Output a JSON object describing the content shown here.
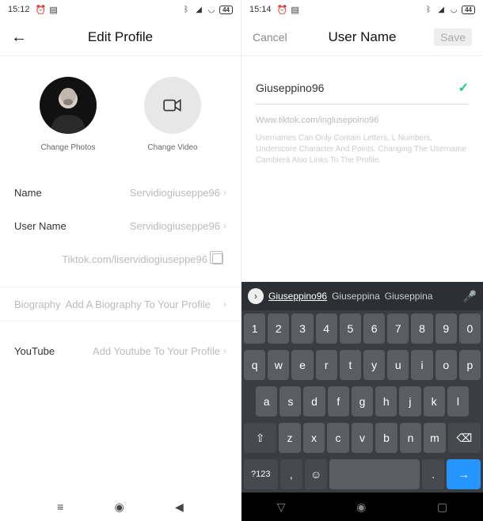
{
  "left": {
    "status": {
      "time": "15:12",
      "battery": "44"
    },
    "header": {
      "title": "Edit Profile"
    },
    "avatars": {
      "photo_label": "Change Photos",
      "video_label": "Change Video"
    },
    "rows": {
      "name_label": "Name",
      "name_value": "Servidiogiuseppe96",
      "username_label": "User Name",
      "username_value": "Servidiogiuseppe96",
      "url": "Tiktok.com/liservidiogiuseppe96",
      "bio_label": "Biography",
      "bio_placeholder": "Add A Biography To Your Profile",
      "youtube_label": "YouTube",
      "youtube_placeholder": "Add Youtube To Your Profile"
    }
  },
  "right": {
    "status": {
      "time": "15:14",
      "battery": "44"
    },
    "header": {
      "cancel": "Cancel",
      "title": "User Name",
      "save": "Save"
    },
    "input": {
      "value": "Giuseppino96",
      "url": "Www.tiktok.com/inglusepoino96",
      "help": "Usernames Can Only Contain Letters, L Numbers, Underscore Character And Points. Changing The Username Cambierà Also Links To The Profile."
    },
    "keyboard": {
      "suggestions": [
        "Giuseppino96",
        "Giuseppina",
        "Giuseppina"
      ],
      "row1": [
        "1",
        "2",
        "3",
        "4",
        "5",
        "6",
        "7",
        "8",
        "9",
        "0"
      ],
      "row2": [
        "q",
        "w",
        "e",
        "r",
        "t",
        "y",
        "u",
        "i",
        "o",
        "p"
      ],
      "row3": [
        "a",
        "s",
        "d",
        "f",
        "g",
        "h",
        "j",
        "k",
        "l"
      ],
      "row4": [
        "z",
        "x",
        "c",
        "v",
        "b",
        "n",
        "m"
      ],
      "sym": "?123",
      "comma": ",",
      "period": "."
    }
  }
}
